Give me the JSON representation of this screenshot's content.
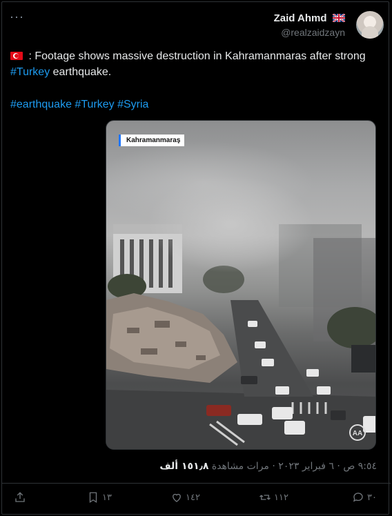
{
  "header": {
    "more_label": "···",
    "author_name": "Zaid Ahmd",
    "author_handle": "@realzaidzayn"
  },
  "tweet": {
    "text_part1": " : Footage shows massive destruction in Kahramanmaras after strong ",
    "hashtag_inline": "#Turkey",
    "text_part2": " earthquake.",
    "hashtags": [
      "#earthquake",
      "#Turkey",
      "#Syria"
    ]
  },
  "media": {
    "location_label": "Kahramanmaraş",
    "logo_text": "AA"
  },
  "meta": {
    "time": "٩:٥٤ ص",
    "separator": " · ",
    "date": "٦ فبراير ٢٠٢٣",
    "views_value": "١٥١٫٨ ألف",
    "views_label": "مرات مشاهدة"
  },
  "actions": {
    "reply_count": "٣٠",
    "retweet_count": "١١٢",
    "like_count": "١٤٢",
    "bookmark_count": "١٣"
  },
  "colors": {
    "accent": "#1d9bf0",
    "background": "#000000",
    "secondary_text": "#71767b"
  }
}
